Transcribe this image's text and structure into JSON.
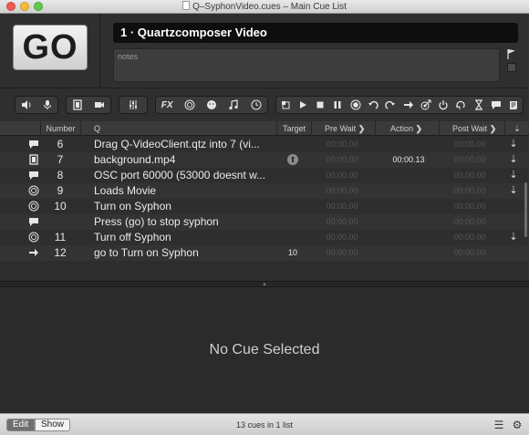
{
  "window": {
    "title": "Q–SyphonVideo.cues – Main Cue List"
  },
  "top": {
    "go_label": "GO",
    "cue_name": "1 · Quartzcomposer Video",
    "notes_placeholder": "notes"
  },
  "toolbar": {
    "groups": [
      [
        "speaker-icon",
        "microphone-icon"
      ],
      [
        "film-icon",
        "camera-icon"
      ],
      [
        "sliders-icon"
      ],
      [
        "fx-icon",
        "target-icon",
        "smile-icon",
        "music-note-icon",
        "clock-icon"
      ],
      [
        "stop-square-icon",
        "play-icon",
        "stop-icon",
        "pause-icon",
        "record-icon",
        "undo-icon",
        "redo-icon",
        "arrow-right-icon",
        "target-arrow-icon",
        "power-icon",
        "loop-icon",
        "hourglass-icon",
        "speech-bubble-icon",
        "script-icon"
      ]
    ],
    "fx_label": "FX"
  },
  "table": {
    "columns": {
      "number": "Number",
      "q": "Q",
      "target": "Target",
      "pre_wait": "Pre Wait",
      "action": "Action",
      "post_wait": "Post Wait"
    },
    "rows": [
      {
        "type_icon": "speech-bubble-icon",
        "number": "6",
        "q": "Drag Q-VideoClient.qtz into 7 (vi...",
        "target": "",
        "pre_wait": "00:00.00",
        "action": "",
        "post_wait": "00:00.00",
        "continue": "⇣"
      },
      {
        "type_icon": "film-icon",
        "number": "7",
        "q": "background.mp4",
        "target": "⬆",
        "pre_wait": "00:00.00",
        "action": "00:00.13",
        "post_wait": "00:00.00",
        "continue": "⇣"
      },
      {
        "type_icon": "speech-bubble-icon",
        "number": "8",
        "q": "OSC port 60000 (53000 doesnt w...",
        "target": "",
        "pre_wait": "00:00.00",
        "action": "",
        "post_wait": "00:00.00",
        "continue": "⇣"
      },
      {
        "type_icon": "target-icon",
        "number": "9",
        "q": "Loads Movie",
        "target": "",
        "pre_wait": "00:00.00",
        "action": "",
        "post_wait": "00:00.00",
        "continue": "⇣"
      },
      {
        "type_icon": "target-icon",
        "number": "10",
        "q": "Turn on Syphon",
        "target": "",
        "pre_wait": "00:00.00",
        "action": "",
        "post_wait": "00:00.00",
        "continue": ""
      },
      {
        "type_icon": "speech-bubble-icon",
        "number": "",
        "q": "Press (go) to stop syphon",
        "target": "",
        "pre_wait": "00:00.00",
        "action": "",
        "post_wait": "00:00.00",
        "continue": ""
      },
      {
        "type_icon": "target-icon",
        "number": "11",
        "q": "Turn off Syphon",
        "target": "",
        "pre_wait": "00:00.00",
        "action": "",
        "post_wait": "00:00.00",
        "continue": "⇣"
      },
      {
        "type_icon": "arrow-right-icon",
        "number": "12",
        "q": "go to Turn on Syphon",
        "target": "10",
        "pre_wait": "00:00.00",
        "action": "",
        "post_wait": "00:00.00",
        "continue": ""
      }
    ]
  },
  "inspector": {
    "empty_text": "No Cue Selected"
  },
  "footer": {
    "edit_label": "Edit",
    "show_label": "Show",
    "status": "13 cues in 1 list"
  }
}
